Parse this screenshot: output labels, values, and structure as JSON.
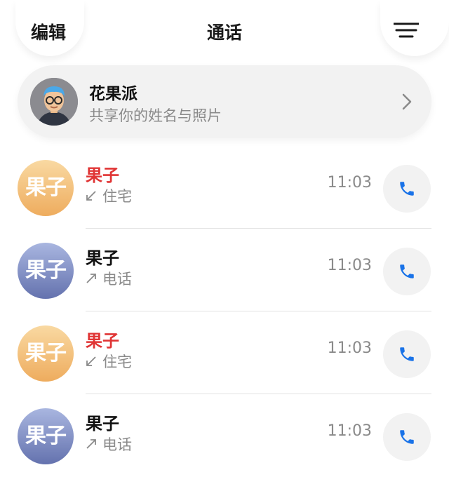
{
  "header": {
    "edit_label": "编辑",
    "title": "通话",
    "menu_icon": "menu-icon"
  },
  "profile": {
    "name": "花果派",
    "subtitle": "共享你的姓名与照片",
    "avatar_icon": "memoji-avatar",
    "chevron_icon": "chevron-right-icon"
  },
  "calls": [
    {
      "avatar_text": "果子",
      "avatar_color": "orange",
      "name": "果子",
      "missed": true,
      "direction_icon": "incoming-arrow-icon",
      "type": "住宅",
      "time": "11:03",
      "call_icon": "phone-icon"
    },
    {
      "avatar_text": "果子",
      "avatar_color": "blue",
      "name": "果子",
      "missed": false,
      "direction_icon": "outgoing-arrow-icon",
      "type": "电话",
      "time": "11:03",
      "call_icon": "phone-icon"
    },
    {
      "avatar_text": "果子",
      "avatar_color": "orange",
      "name": "果子",
      "missed": true,
      "direction_icon": "incoming-arrow-icon",
      "type": "住宅",
      "time": "11:03",
      "call_icon": "phone-icon"
    },
    {
      "avatar_text": "果子",
      "avatar_color": "blue",
      "name": "果子",
      "missed": false,
      "direction_icon": "outgoing-arrow-icon",
      "type": "电话",
      "time": "11:03",
      "call_icon": "phone-icon"
    }
  ],
  "colors": {
    "missed_red": "#e03535",
    "phone_blue": "#1a73e8",
    "secondary_text": "#8a8a8a"
  }
}
